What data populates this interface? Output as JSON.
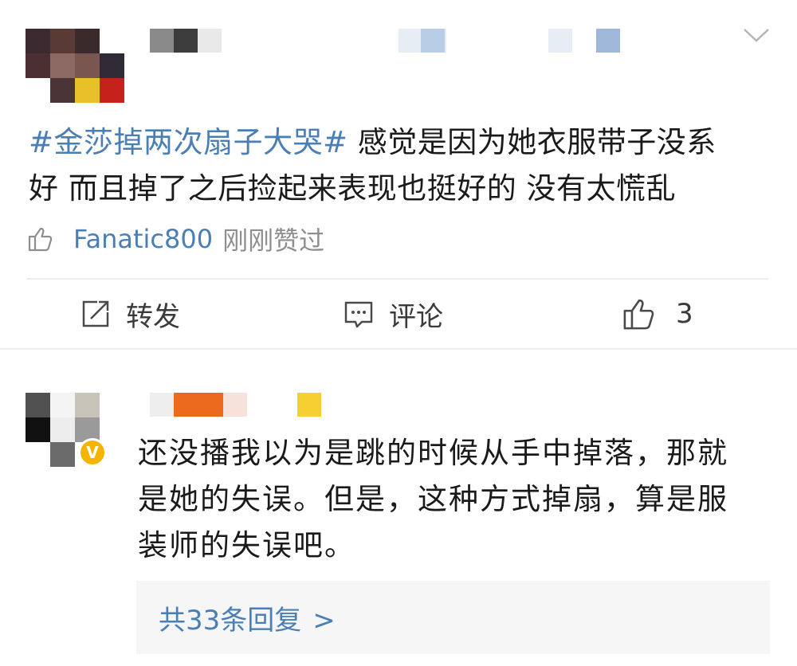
{
  "post": {
    "topic": "#金莎掉两次扇子大哭#",
    "text_line1": " 感觉是因为她衣服带子没系",
    "text_line2": "好 而且掉了之后捡起来表现也挺好的 没有太慌乱"
  },
  "like_info": {
    "user": "Fanatic800",
    "time": "刚刚赞过"
  },
  "actions": {
    "repost_label": "转发",
    "comment_label": "评论",
    "like_count": "3"
  },
  "comment": {
    "line1": "还没播我以为是跳的时候从手中掉落，那就",
    "line2": "是她的失误。但是，这种方式掉扇，算是服",
    "line3": "装师的失误吧。",
    "replies_label": "共33条回复",
    "replies_chevron": ">"
  },
  "icons": {
    "dropdown": "chevron-down-icon",
    "like_small": "thumbs-up-icon",
    "repost": "repost-icon",
    "comment": "comment-icon",
    "like": "thumbs-up-icon",
    "verified": "verified-badge-icon"
  },
  "colors": {
    "link": "#4a7fb5",
    "text": "#1a1a1a",
    "muted": "#8e8e8e",
    "badge": "#f5b400"
  }
}
